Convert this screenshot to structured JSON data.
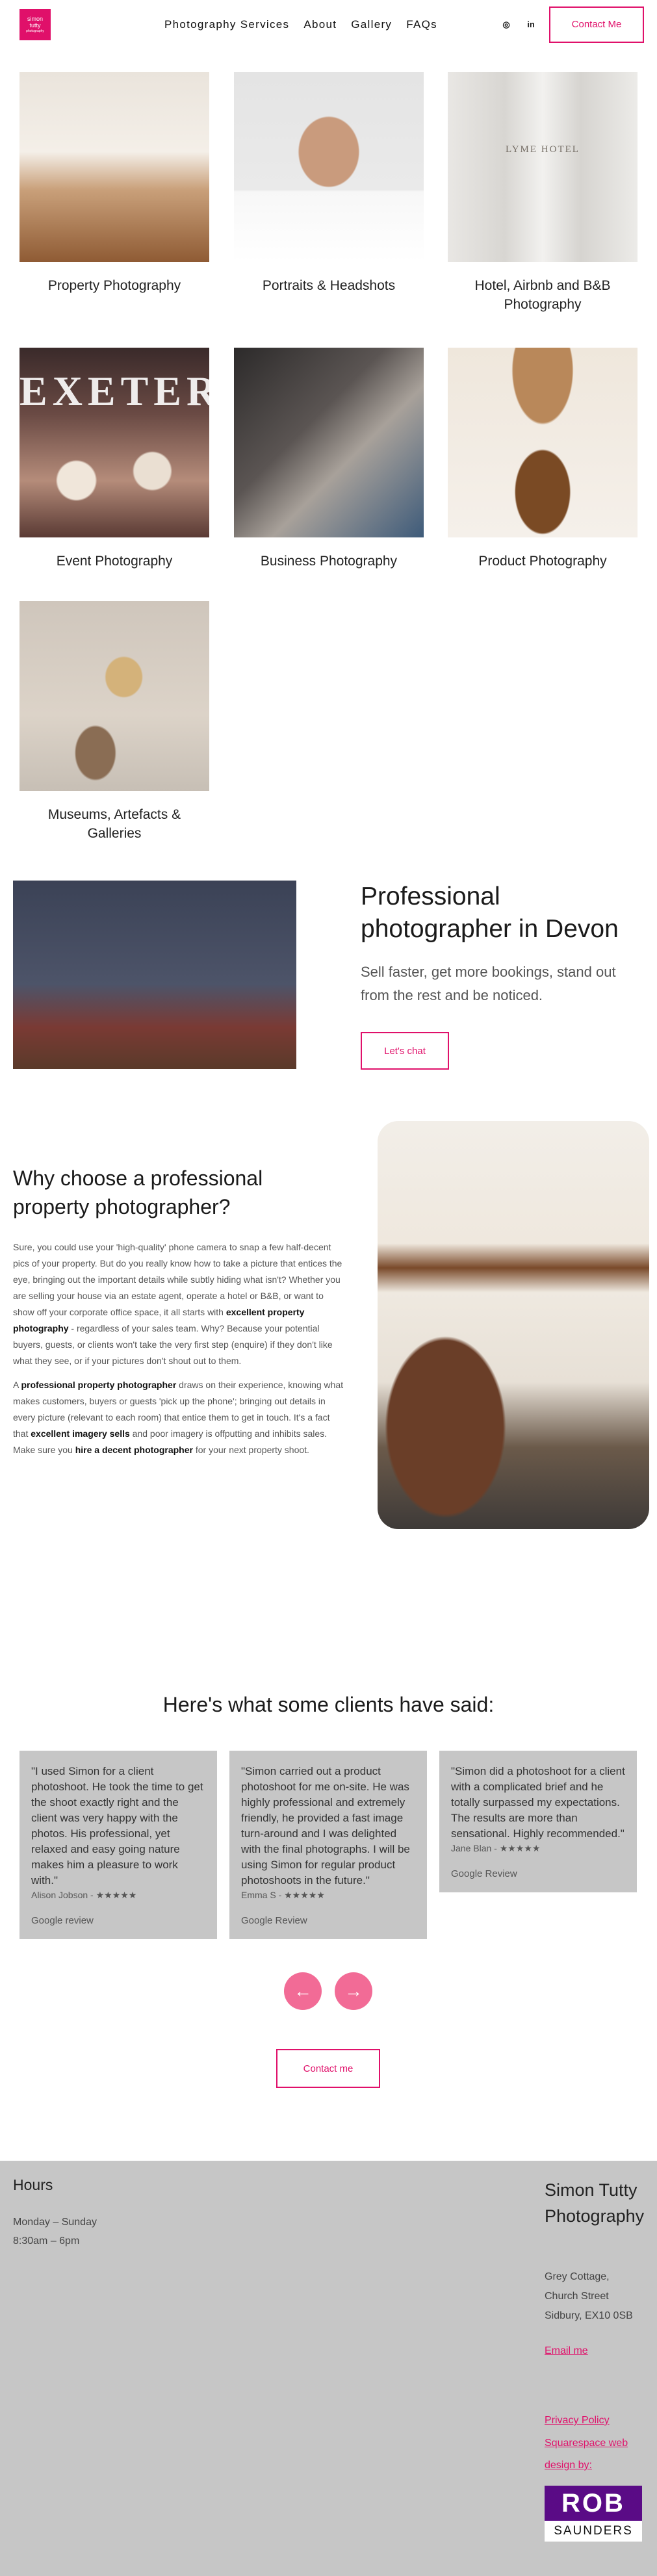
{
  "header": {
    "logo_line1": "simon",
    "logo_line2": "tutty",
    "logo_line3": "photography",
    "nav": [
      "Photography Services",
      "About",
      "Gallery",
      "FAQs"
    ],
    "contact_label": "Contact Me",
    "icons": [
      "instagram-icon",
      "linkedin-icon"
    ],
    "instagram_glyph": "◎",
    "linkedin_glyph": "in"
  },
  "gallery": {
    "items": [
      {
        "caption": "Property Photography",
        "image": "kitchen-photo"
      },
      {
        "caption": "Portraits & Headshots",
        "image": "portrait-photo"
      },
      {
        "caption": "Hotel, Airbnb and B&B Photography",
        "image": "hotel-bottles-photo"
      },
      {
        "caption": "Event Photography",
        "image": "event-photo"
      },
      {
        "caption": "Business Photography",
        "image": "coffee-photo"
      },
      {
        "caption": "Product Photography",
        "image": "cookie-jar-photo"
      },
      {
        "caption": "Museums, Artefacts & Galleries",
        "image": "museum-photo"
      }
    ],
    "bottle_label": "LYME HOTEL",
    "event_label": "EXETER"
  },
  "professional": {
    "title": "Professional photographer in Devon",
    "subtitle": "Sell faster, get more bookings, stand out from the rest and be noticed.",
    "button": "Let's chat"
  },
  "why": {
    "title": "Why choose a professional property photographer?",
    "p1_a": "Sure, you could use your 'high-quality' phone camera to snap a few half-decent pics of your property. But do you really know how to take a picture that entices the eye, bringing out the important details while subtly hiding what isn't? Whether you are selling your house via an estate agent, operate a hotel or B&B, or want to show off your corporate office space, it all starts with ",
    "p1_b": "excellent property photography",
    "p1_c": " - regardless of your sales team. Why? Because your potential buyers, guests, or clients won't take the very first step (enquire) if they don't like what they see, or if your pictures don't shout out to them.",
    "p2_a": "A ",
    "p2_b": "professional property photographer",
    "p2_c": " draws on their experience, knowing what makes customers, buyers or guests 'pick up the phone'; bringing out details in every picture (relevant to each room) that entice them to get in touch. It's a fact that ",
    "p2_d": "excellent imagery sells",
    "p2_e": " and poor imagery is offputting and inhibits sales. Make sure you ",
    "p2_f": "hire a decent photographer",
    "p2_g": " for your next property shoot."
  },
  "testimonials": {
    "title": "Here's what some clients have said:",
    "items": [
      {
        "quote": "\"I used Simon for a client photoshoot. He took the time to get the shoot exactly right and the client was very happy with the photos. His professional, yet relaxed and easy going nature makes him a pleasure to work with.\"",
        "name": "Alison Jobson - ★★★★★",
        "source": "Google review"
      },
      {
        "quote": "\"Simon carried out a product photoshoot for me on-site. He was highly professional and extremely friendly, he provided a fast image turn-around and I was delighted with the final photographs. I will be using Simon for regular product photoshoots in the future.\"",
        "name": "Emma S - ★★★★★",
        "source": "Google Review"
      },
      {
        "quote": "\"Simon did a photoshoot for a client with a complicated brief and he totally surpassed my expectations. The results are more than sensational. Highly recommended.\"",
        "name": "Jane Blan - ★★★★★",
        "source": "Google Review"
      }
    ],
    "prev_glyph": "←",
    "next_glyph": "→",
    "contact_button": "Contact me"
  },
  "footer": {
    "hours_title": "Hours",
    "hours_days": "Monday – Sunday",
    "hours_time": "8:30am – 6pm",
    "business_name": "Simon Tutty Photography",
    "address_1": "Grey Cottage,",
    "address_2": "Church Street",
    "address_3": "Sidbury, EX10 0SB",
    "email_link": "Email me",
    "privacy_link": "Privacy Policy",
    "credit_link": "Squarespace web design by:",
    "credit_logo_top": "ROB",
    "credit_logo_bottom": "SAUNDERS"
  }
}
